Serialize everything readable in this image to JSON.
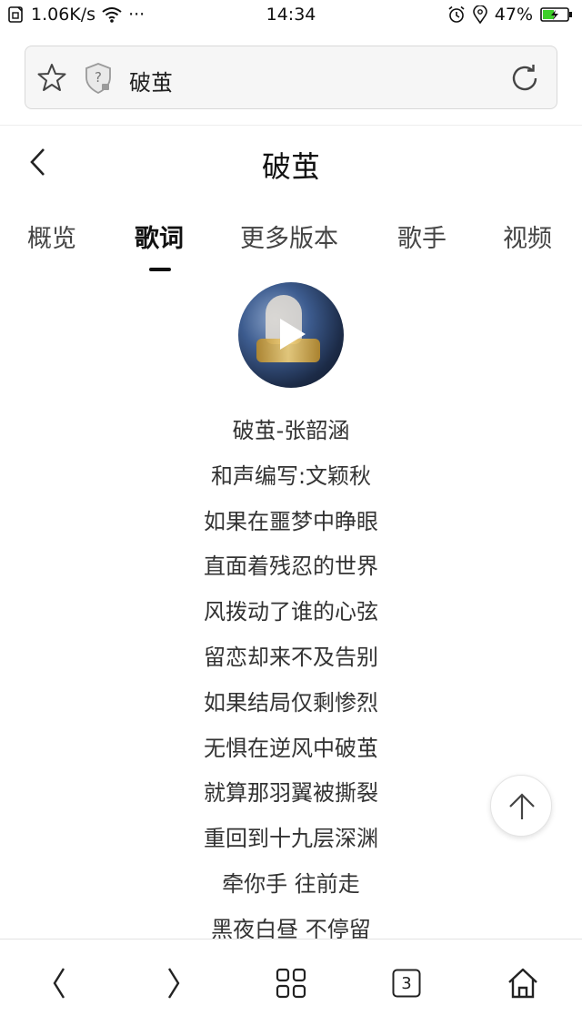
{
  "status_bar": {
    "network_speed": "1.06K/s",
    "dots": "···",
    "time": "14:34",
    "battery_percent": "47%",
    "battery_level": 0.47,
    "icons": [
      "sim-icon",
      "wifi-icon",
      "alarm-icon",
      "location-icon",
      "battery-charging-icon"
    ]
  },
  "address_bar": {
    "url_text": "破茧",
    "icons": [
      "star-icon",
      "shield-question-icon",
      "refresh-icon"
    ]
  },
  "page_header": {
    "title": "破茧"
  },
  "tabs": [
    {
      "label": "概览",
      "active": false
    },
    {
      "label": "歌词",
      "active": true
    },
    {
      "label": "更多版本",
      "active": false
    },
    {
      "label": "歌手",
      "active": false
    },
    {
      "label": "视频",
      "active": false
    }
  ],
  "lyrics": [
    "破茧-张韶涵",
    "和声编写:文颖秋",
    "如果在噩梦中睁眼",
    "直面着残忍的世界",
    "风拨动了谁的心弦",
    "留恋却来不及告别",
    "如果结局仅剩惨烈",
    "无惧在逆风中破茧",
    "就算那羽翼被撕裂",
    "重回到十九层深渊",
    "牵你手 往前走",
    "黑夜白昼 不停留"
  ],
  "bottom_nav": {
    "tab_count": "3",
    "icons": [
      "back-arrow-icon",
      "forward-arrow-icon",
      "grid-menu-icon",
      "tabs-icon",
      "home-icon"
    ]
  },
  "colors": {
    "text_primary": "#111111",
    "text_secondary": "#444444",
    "battery_fill": "#3ecf2a",
    "divider": "#e3e3e3"
  }
}
